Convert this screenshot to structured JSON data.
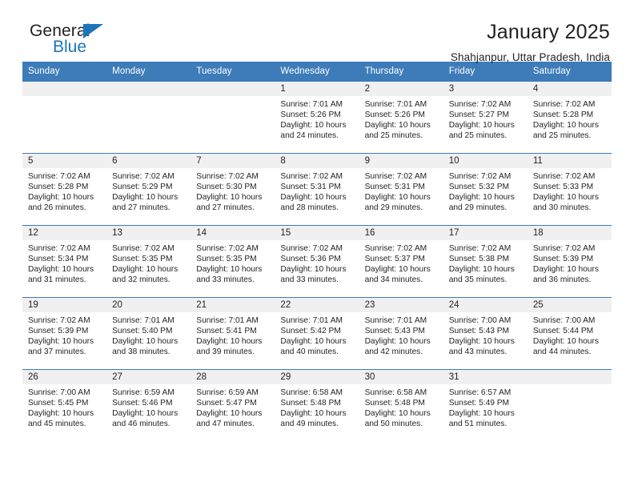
{
  "brand": {
    "name_part1": "General",
    "name_part2": "Blue",
    "accent_color": "#1b75bb",
    "triangle_icon": "brand-triangle-icon"
  },
  "header": {
    "title": "January 2025",
    "subtitle": "Shahjanpur, Uttar Pradesh, India"
  },
  "calendar": {
    "header_color": "#3d7cb8",
    "daystrip_color": "#f0f0f0",
    "weekdays": [
      "Sunday",
      "Monday",
      "Tuesday",
      "Wednesday",
      "Thursday",
      "Friday",
      "Saturday"
    ],
    "weeks": [
      [
        {
          "day": "",
          "empty": true,
          "sunrise": "",
          "sunset": "",
          "daylight_1": "",
          "daylight_2": ""
        },
        {
          "day": "",
          "empty": true,
          "sunrise": "",
          "sunset": "",
          "daylight_1": "",
          "daylight_2": ""
        },
        {
          "day": "",
          "empty": true,
          "sunrise": "",
          "sunset": "",
          "daylight_1": "",
          "daylight_2": ""
        },
        {
          "day": "1",
          "empty": false,
          "sunrise": "Sunrise: 7:01 AM",
          "sunset": "Sunset: 5:26 PM",
          "daylight_1": "Daylight: 10 hours",
          "daylight_2": "and 24 minutes."
        },
        {
          "day": "2",
          "empty": false,
          "sunrise": "Sunrise: 7:01 AM",
          "sunset": "Sunset: 5:26 PM",
          "daylight_1": "Daylight: 10 hours",
          "daylight_2": "and 25 minutes."
        },
        {
          "day": "3",
          "empty": false,
          "sunrise": "Sunrise: 7:02 AM",
          "sunset": "Sunset: 5:27 PM",
          "daylight_1": "Daylight: 10 hours",
          "daylight_2": "and 25 minutes."
        },
        {
          "day": "4",
          "empty": false,
          "sunrise": "Sunrise: 7:02 AM",
          "sunset": "Sunset: 5:28 PM",
          "daylight_1": "Daylight: 10 hours",
          "daylight_2": "and 25 minutes."
        }
      ],
      [
        {
          "day": "5",
          "empty": false,
          "sunrise": "Sunrise: 7:02 AM",
          "sunset": "Sunset: 5:28 PM",
          "daylight_1": "Daylight: 10 hours",
          "daylight_2": "and 26 minutes."
        },
        {
          "day": "6",
          "empty": false,
          "sunrise": "Sunrise: 7:02 AM",
          "sunset": "Sunset: 5:29 PM",
          "daylight_1": "Daylight: 10 hours",
          "daylight_2": "and 27 minutes."
        },
        {
          "day": "7",
          "empty": false,
          "sunrise": "Sunrise: 7:02 AM",
          "sunset": "Sunset: 5:30 PM",
          "daylight_1": "Daylight: 10 hours",
          "daylight_2": "and 27 minutes."
        },
        {
          "day": "8",
          "empty": false,
          "sunrise": "Sunrise: 7:02 AM",
          "sunset": "Sunset: 5:31 PM",
          "daylight_1": "Daylight: 10 hours",
          "daylight_2": "and 28 minutes."
        },
        {
          "day": "9",
          "empty": false,
          "sunrise": "Sunrise: 7:02 AM",
          "sunset": "Sunset: 5:31 PM",
          "daylight_1": "Daylight: 10 hours",
          "daylight_2": "and 29 minutes."
        },
        {
          "day": "10",
          "empty": false,
          "sunrise": "Sunrise: 7:02 AM",
          "sunset": "Sunset: 5:32 PM",
          "daylight_1": "Daylight: 10 hours",
          "daylight_2": "and 29 minutes."
        },
        {
          "day": "11",
          "empty": false,
          "sunrise": "Sunrise: 7:02 AM",
          "sunset": "Sunset: 5:33 PM",
          "daylight_1": "Daylight: 10 hours",
          "daylight_2": "and 30 minutes."
        }
      ],
      [
        {
          "day": "12",
          "empty": false,
          "sunrise": "Sunrise: 7:02 AM",
          "sunset": "Sunset: 5:34 PM",
          "daylight_1": "Daylight: 10 hours",
          "daylight_2": "and 31 minutes."
        },
        {
          "day": "13",
          "empty": false,
          "sunrise": "Sunrise: 7:02 AM",
          "sunset": "Sunset: 5:35 PM",
          "daylight_1": "Daylight: 10 hours",
          "daylight_2": "and 32 minutes."
        },
        {
          "day": "14",
          "empty": false,
          "sunrise": "Sunrise: 7:02 AM",
          "sunset": "Sunset: 5:35 PM",
          "daylight_1": "Daylight: 10 hours",
          "daylight_2": "and 33 minutes."
        },
        {
          "day": "15",
          "empty": false,
          "sunrise": "Sunrise: 7:02 AM",
          "sunset": "Sunset: 5:36 PM",
          "daylight_1": "Daylight: 10 hours",
          "daylight_2": "and 33 minutes."
        },
        {
          "day": "16",
          "empty": false,
          "sunrise": "Sunrise: 7:02 AM",
          "sunset": "Sunset: 5:37 PM",
          "daylight_1": "Daylight: 10 hours",
          "daylight_2": "and 34 minutes."
        },
        {
          "day": "17",
          "empty": false,
          "sunrise": "Sunrise: 7:02 AM",
          "sunset": "Sunset: 5:38 PM",
          "daylight_1": "Daylight: 10 hours",
          "daylight_2": "and 35 minutes."
        },
        {
          "day": "18",
          "empty": false,
          "sunrise": "Sunrise: 7:02 AM",
          "sunset": "Sunset: 5:39 PM",
          "daylight_1": "Daylight: 10 hours",
          "daylight_2": "and 36 minutes."
        }
      ],
      [
        {
          "day": "19",
          "empty": false,
          "sunrise": "Sunrise: 7:02 AM",
          "sunset": "Sunset: 5:39 PM",
          "daylight_1": "Daylight: 10 hours",
          "daylight_2": "and 37 minutes."
        },
        {
          "day": "20",
          "empty": false,
          "sunrise": "Sunrise: 7:01 AM",
          "sunset": "Sunset: 5:40 PM",
          "daylight_1": "Daylight: 10 hours",
          "daylight_2": "and 38 minutes."
        },
        {
          "day": "21",
          "empty": false,
          "sunrise": "Sunrise: 7:01 AM",
          "sunset": "Sunset: 5:41 PM",
          "daylight_1": "Daylight: 10 hours",
          "daylight_2": "and 39 minutes."
        },
        {
          "day": "22",
          "empty": false,
          "sunrise": "Sunrise: 7:01 AM",
          "sunset": "Sunset: 5:42 PM",
          "daylight_1": "Daylight: 10 hours",
          "daylight_2": "and 40 minutes."
        },
        {
          "day": "23",
          "empty": false,
          "sunrise": "Sunrise: 7:01 AM",
          "sunset": "Sunset: 5:43 PM",
          "daylight_1": "Daylight: 10 hours",
          "daylight_2": "and 42 minutes."
        },
        {
          "day": "24",
          "empty": false,
          "sunrise": "Sunrise: 7:00 AM",
          "sunset": "Sunset: 5:43 PM",
          "daylight_1": "Daylight: 10 hours",
          "daylight_2": "and 43 minutes."
        },
        {
          "day": "25",
          "empty": false,
          "sunrise": "Sunrise: 7:00 AM",
          "sunset": "Sunset: 5:44 PM",
          "daylight_1": "Daylight: 10 hours",
          "daylight_2": "and 44 minutes."
        }
      ],
      [
        {
          "day": "26",
          "empty": false,
          "sunrise": "Sunrise: 7:00 AM",
          "sunset": "Sunset: 5:45 PM",
          "daylight_1": "Daylight: 10 hours",
          "daylight_2": "and 45 minutes."
        },
        {
          "day": "27",
          "empty": false,
          "sunrise": "Sunrise: 6:59 AM",
          "sunset": "Sunset: 5:46 PM",
          "daylight_1": "Daylight: 10 hours",
          "daylight_2": "and 46 minutes."
        },
        {
          "day": "28",
          "empty": false,
          "sunrise": "Sunrise: 6:59 AM",
          "sunset": "Sunset: 5:47 PM",
          "daylight_1": "Daylight: 10 hours",
          "daylight_2": "and 47 minutes."
        },
        {
          "day": "29",
          "empty": false,
          "sunrise": "Sunrise: 6:58 AM",
          "sunset": "Sunset: 5:48 PM",
          "daylight_1": "Daylight: 10 hours",
          "daylight_2": "and 49 minutes."
        },
        {
          "day": "30",
          "empty": false,
          "sunrise": "Sunrise: 6:58 AM",
          "sunset": "Sunset: 5:48 PM",
          "daylight_1": "Daylight: 10 hours",
          "daylight_2": "and 50 minutes."
        },
        {
          "day": "31",
          "empty": false,
          "sunrise": "Sunrise: 6:57 AM",
          "sunset": "Sunset: 5:49 PM",
          "daylight_1": "Daylight: 10 hours",
          "daylight_2": "and 51 minutes."
        },
        {
          "day": "",
          "empty": true,
          "sunrise": "",
          "sunset": "",
          "daylight_1": "",
          "daylight_2": ""
        }
      ]
    ]
  }
}
